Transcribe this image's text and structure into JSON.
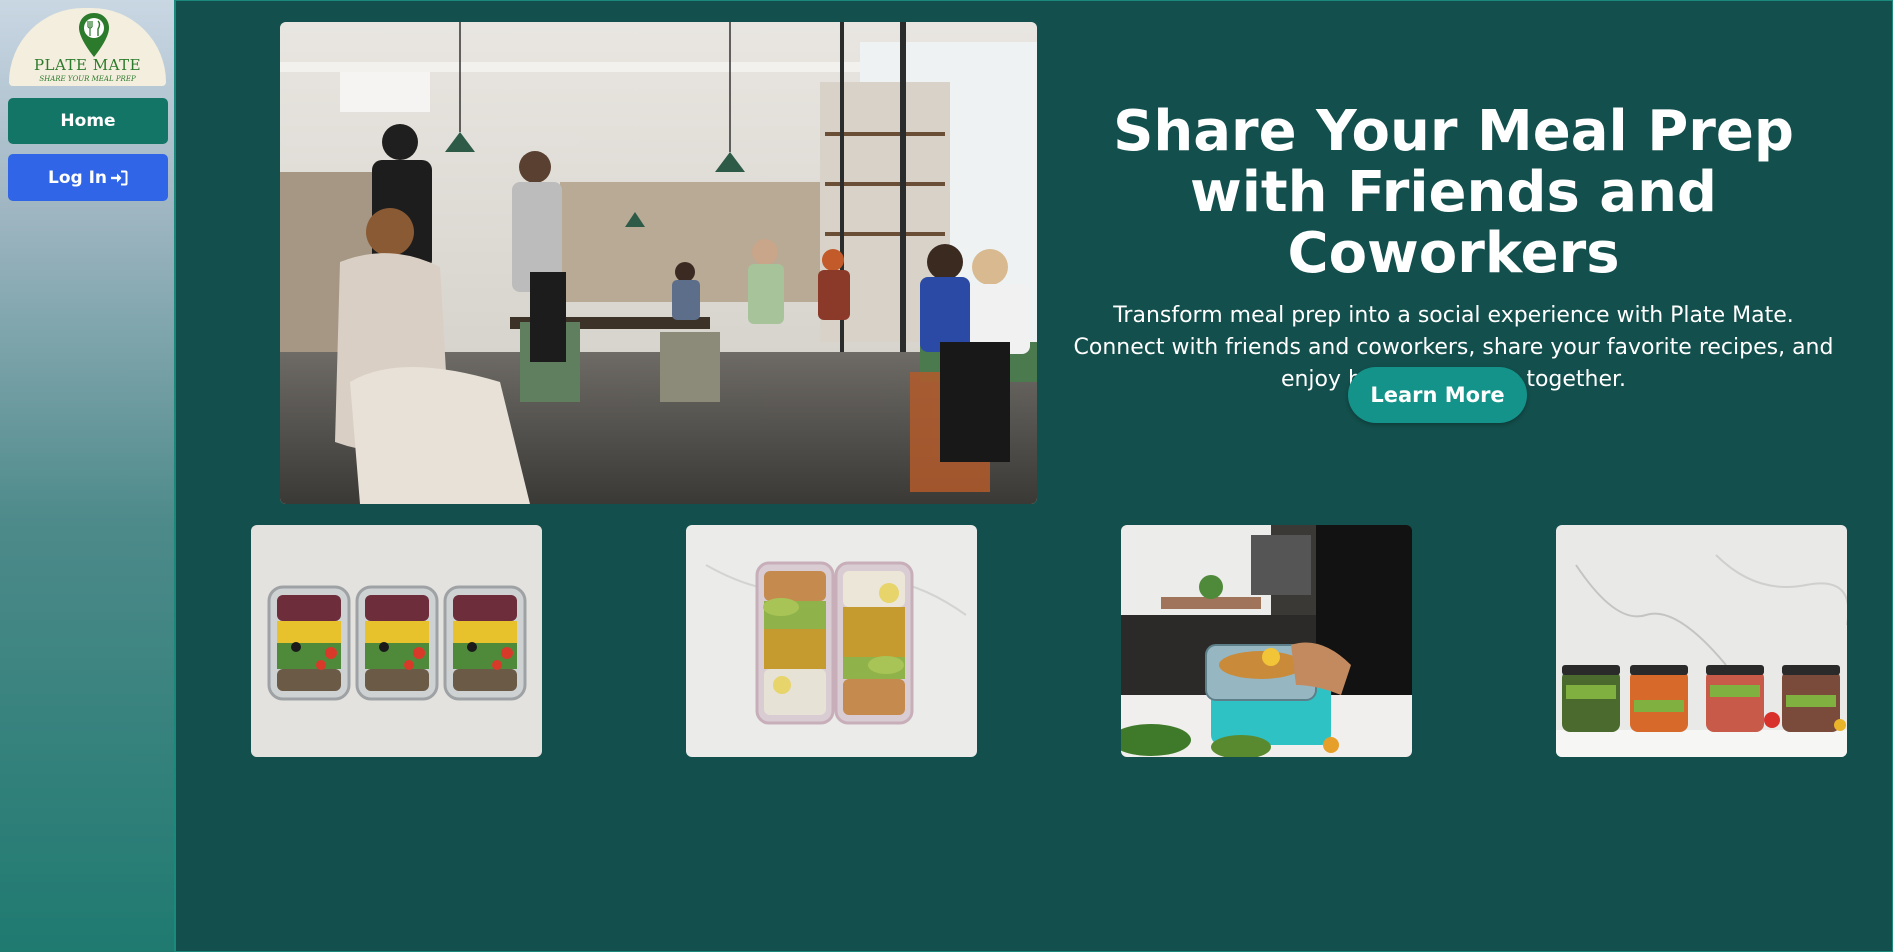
{
  "brand": {
    "name": "PLATE MATE",
    "tagline": "SHARE YOUR MEAL PREP",
    "colors": {
      "green": "#2c7a2b",
      "cream": "#f3eede"
    }
  },
  "sidebar": {
    "items": [
      {
        "label": "Home",
        "color": "#137566"
      },
      {
        "label": "Log In",
        "icon": "login-arrow-icon",
        "color": "#2f65e6"
      }
    ]
  },
  "hero": {
    "title": "Share Your Meal Prep with Friends and Coworkers",
    "description": "Transform meal prep into a social experience with Plate Mate. Connect with friends and coworkers, share your favorite recipes, and enjoy healthier meals together.",
    "cta_label": "Learn More",
    "image": "cafe-photo"
  },
  "gallery": [
    {
      "image": "three-meal-prep-containers-photo"
    },
    {
      "image": "two-meal-prep-containers-photo"
    },
    {
      "image": "packing-meal-container-photo"
    },
    {
      "image": "salad-jars-photo"
    }
  ],
  "colors": {
    "main_bg": "#134f4c",
    "cta_bg": "#14938a",
    "accent_border": "#1b8a7d"
  }
}
